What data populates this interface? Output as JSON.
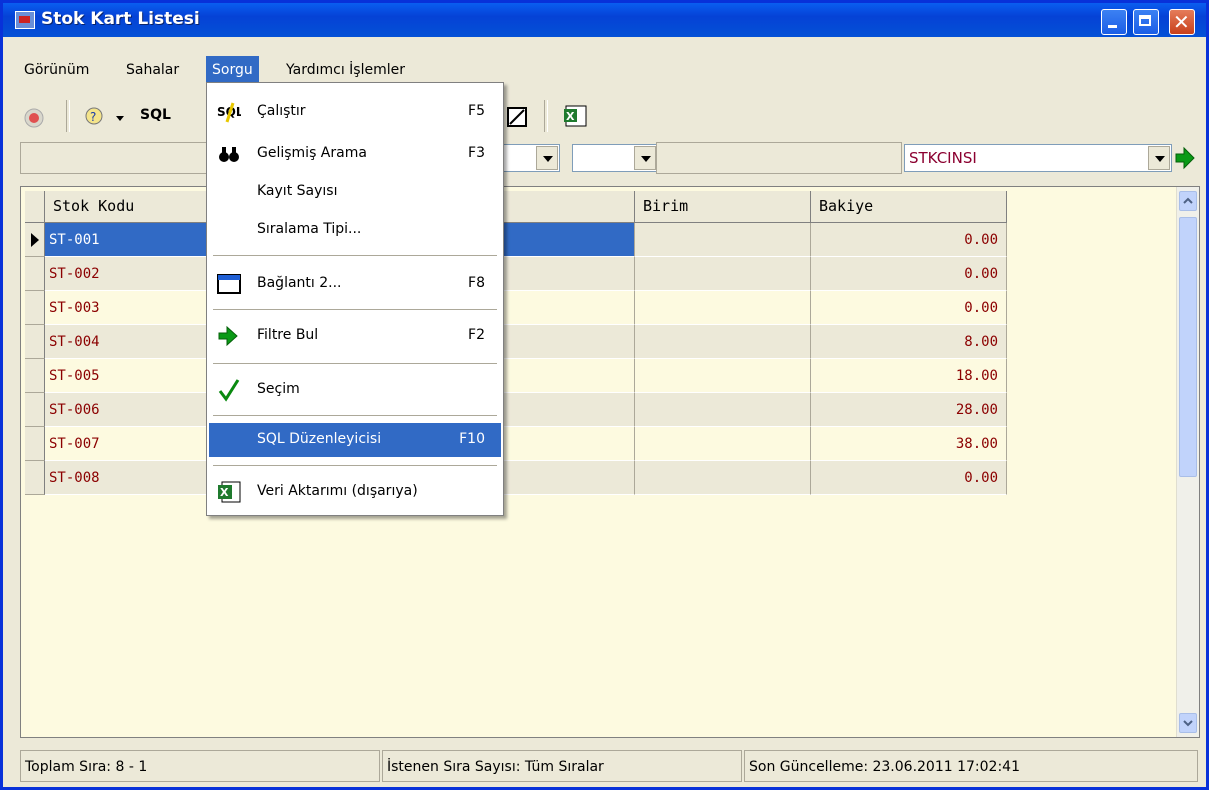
{
  "window": {
    "title": "Stok Kart Listesi"
  },
  "menubar": {
    "items": [
      "Görünüm",
      "Sahalar",
      "Sorgu",
      "Yardımcı İşlemler"
    ]
  },
  "toolbar": {
    "sql_label": "SQL"
  },
  "filter": {
    "field_combo": "STKCINSI"
  },
  "grid": {
    "columns": [
      "Stok Kodu",
      "Birim",
      "Bakiye"
    ],
    "rows": [
      {
        "code": "ST-001",
        "balance": "0.00"
      },
      {
        "code": "ST-002",
        "balance": "0.00"
      },
      {
        "code": "ST-003",
        "balance": "0.00"
      },
      {
        "code": "ST-004",
        "balance": "8.00"
      },
      {
        "code": "ST-005",
        "balance": "18.00"
      },
      {
        "code": "ST-006",
        "balance": "28.00"
      },
      {
        "code": "ST-007",
        "balance": "38.00"
      },
      {
        "code": "ST-008",
        "balance": "0.00"
      }
    ]
  },
  "dropdown": {
    "items": [
      {
        "label": "Çalıştır",
        "key": "F5",
        "icon": "sql-icon"
      },
      {
        "label": "Gelişmiş Arama",
        "key": "F3",
        "icon": "binoculars-icon"
      },
      {
        "label": "Kayıt Sayısı",
        "key": ""
      },
      {
        "label": "Sıralama Tipi...",
        "key": ""
      },
      {
        "label": "Bağlantı 2...",
        "key": "F8",
        "icon": "window-icon"
      },
      {
        "label": "Filtre Bul",
        "key": "F2",
        "icon": "green-arrow-icon"
      },
      {
        "label": "Seçim",
        "key": "",
        "icon": "checkmark-icon"
      },
      {
        "label": "SQL Düzenleyicisi",
        "key": "F10"
      },
      {
        "label": "Veri Aktarımı (dışarıya)",
        "key": "",
        "icon": "excel-icon"
      }
    ]
  },
  "status": {
    "total_rows": "Toplam Sıra: 8 - 1",
    "requested": "İstenen Sıra Sayısı: Tüm Sıralar",
    "last_update": "Son Güncelleme: 23.06.2011 17:02:41"
  },
  "colors": {
    "selection": "#316ac5",
    "grid_bg": "#fdfae0",
    "row_text": "#8b0000"
  }
}
